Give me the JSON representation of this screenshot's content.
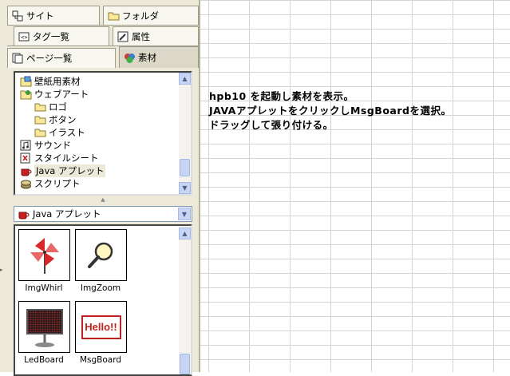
{
  "tabs": {
    "site": "サイト",
    "folder": "フォルダ",
    "tag_list": "タグ一覧",
    "attribute": "属性",
    "page_list": "ページ一覧",
    "material": "素材"
  },
  "tree": {
    "items": [
      {
        "label": "壁紙用素材",
        "icon": "wallpaper-icon"
      },
      {
        "label": "ウェブアート",
        "icon": "webart-icon"
      },
      {
        "label": "ロゴ",
        "icon": "folder-icon"
      },
      {
        "label": "ボタン",
        "icon": "folder-icon"
      },
      {
        "label": "イラスト",
        "icon": "folder-icon"
      },
      {
        "label": "サウンド",
        "icon": "sound-icon"
      },
      {
        "label": "スタイルシート",
        "icon": "stylesheet-icon"
      },
      {
        "label": "Java アプレット",
        "icon": "java-icon"
      },
      {
        "label": "スクリプト",
        "icon": "script-icon"
      }
    ],
    "selected_index": 7
  },
  "combo": {
    "selected": "Java アプレット"
  },
  "gallery": {
    "items": [
      {
        "name": "ImgWhirl",
        "icon": "pinwheel-icon"
      },
      {
        "name": "ImgZoom",
        "icon": "magnifier-icon"
      },
      {
        "name": "LedBoard",
        "icon": "led-board-icon"
      },
      {
        "name": "MsgBoard",
        "icon": "msgboard-icon",
        "preview_text": "Hello!!"
      }
    ]
  },
  "instructions": {
    "line1": "hpb10 を起動し素材を表示。",
    "line2": "JAVAアプレットをクリックしMsgBoardを選択。",
    "line3": "ドラッグして張り付ける。"
  }
}
